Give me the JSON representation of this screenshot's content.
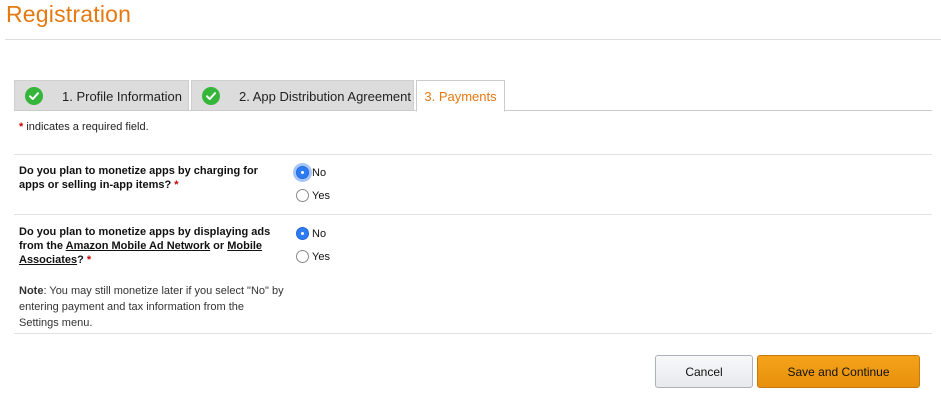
{
  "page": {
    "title": "Registration"
  },
  "tabs": [
    {
      "label": "1. Profile Information",
      "completed": true
    },
    {
      "label": "2. App Distribution Agreement",
      "completed": true
    },
    {
      "label": "3. Payments",
      "completed": false,
      "active": true
    }
  ],
  "required_note": {
    "asterisk": "*",
    "text": " indicates a required field."
  },
  "questions": [
    {
      "text": "Do you plan to monetize apps by charging for apps or selling in-app items?",
      "required_mark": "*",
      "options": [
        {
          "label": "No",
          "selected": true
        },
        {
          "label": "Yes",
          "selected": false
        }
      ]
    },
    {
      "text_before": "Do you plan to monetize apps by displaying ads from the ",
      "link1": "Amazon Mobile Ad Network",
      "text_mid": " or ",
      "link2": "Mobile Associates",
      "text_after": "?",
      "required_mark": "*",
      "options": [
        {
          "label": "No",
          "selected": true
        },
        {
          "label": "Yes",
          "selected": false
        }
      ],
      "note": {
        "label": "Note",
        "text": ": You may still monetize later if you select \"No\" by entering payment and tax information from the Settings menu."
      }
    }
  ],
  "buttons": {
    "cancel": "Cancel",
    "save": "Save and Continue"
  },
  "colors": {
    "accent": "#e47911",
    "check": "#35b63a",
    "radio_selected": "#2d7cf5",
    "primary_button": "#f0a30a"
  },
  "icons": {
    "tab_completed": "check-circle-icon"
  }
}
